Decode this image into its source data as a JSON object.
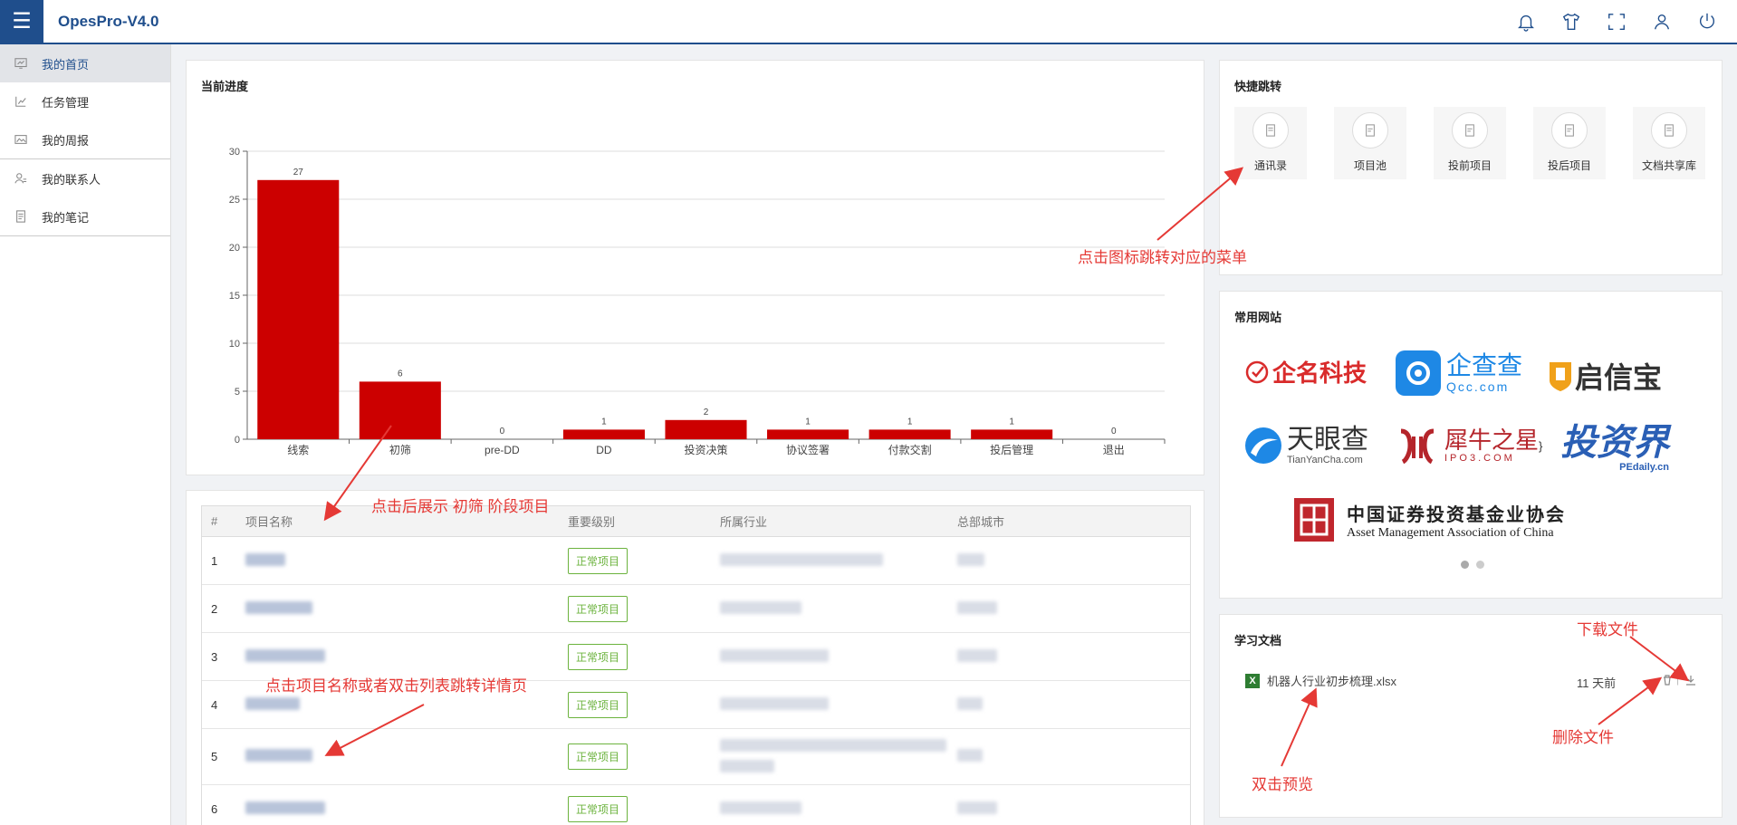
{
  "header": {
    "app_title": "OpesPro-V4.0",
    "icons": [
      "bell-icon",
      "shirt-icon",
      "fullscreen-icon",
      "user-icon",
      "power-icon"
    ]
  },
  "sidebar": {
    "items": [
      {
        "label": "我的首页",
        "icon": "dashboard-icon",
        "active": true
      },
      {
        "label": "任务管理",
        "icon": "task-chart-icon"
      },
      {
        "label": "我的周报",
        "icon": "report-image-icon"
      },
      {
        "label": "我的联系人",
        "icon": "contacts-icon"
      },
      {
        "label": "我的笔记",
        "icon": "notes-icon"
      }
    ]
  },
  "progress": {
    "title": "当前进度"
  },
  "chart_data": {
    "type": "bar",
    "categories": [
      "线索",
      "初筛",
      "pre-DD",
      "DD",
      "投资决策",
      "协议签署",
      "付款交割",
      "投后管理",
      "退出"
    ],
    "values": [
      27,
      6,
      0,
      1,
      2,
      1,
      1,
      1,
      0
    ],
    "yticks": [
      0,
      5,
      10,
      15,
      20,
      25,
      30
    ],
    "ylim": [
      0,
      30
    ],
    "color": "#cc0000",
    "grid": true
  },
  "table": {
    "headers": [
      "#",
      "项目名称",
      "重要级别",
      "所属行业",
      "总部城市"
    ],
    "rows": [
      {
        "num": "1",
        "level": "正常项目"
      },
      {
        "num": "2",
        "level": "正常项目"
      },
      {
        "num": "3",
        "level": "正常项目"
      },
      {
        "num": "4",
        "level": "正常项目"
      },
      {
        "num": "5",
        "level": "正常项目"
      },
      {
        "num": "6",
        "level": "正常项目"
      }
    ]
  },
  "quick_jump": {
    "title": "快捷跳转",
    "items": [
      "通讯录",
      "项目池",
      "投前项目",
      "投后项目",
      "文档共享库"
    ]
  },
  "websites": {
    "title": "常用网站",
    "logos": {
      "qiming": "企名科技",
      "qcc_cn": "企查查",
      "qcc_en": "Qcc.com",
      "qixin": "启信宝",
      "tianyan_cn": "天眼查",
      "tianyan_en": "TianYanCha.com",
      "xiniu_cn": "犀牛之星",
      "xiniu_en": "IPO3.COM",
      "touzijie": "投资界",
      "touzijie_en": "PEdaily.cn",
      "amac_cn": "中国证券投资基金业协会",
      "amac_en": "Asset Management Association of China"
    }
  },
  "docs": {
    "title": "学习文档",
    "file_name": "机器人行业初步梳理.xlsx",
    "time": "11 天前",
    "file_icon": "X"
  },
  "annotations": {
    "icon_jump": "点击图标跳转对应的菜单",
    "chart_click": "点击后展示 初筛 阶段项目",
    "name_click": "点击项目名称或者双击列表跳转详情页",
    "download": "下载文件",
    "delete": "删除文件",
    "preview": "双击预览"
  },
  "colors": {
    "brand": "#1f4e8c",
    "bar": "#cc0000",
    "level_green": "#6cb33e",
    "annotation_red": "#e53935"
  }
}
